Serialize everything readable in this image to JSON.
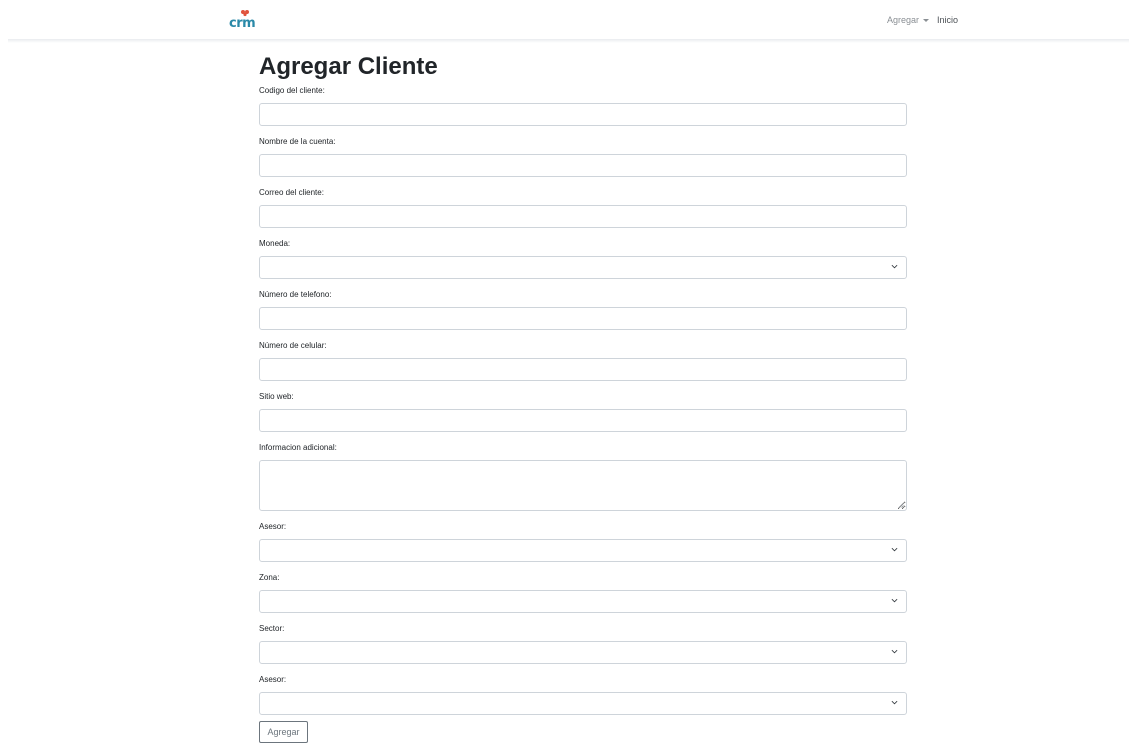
{
  "navbar": {
    "brand": "crm",
    "dropdown_label": "Agregar",
    "link_label": "Inicio"
  },
  "page": {
    "title": "Agregar Cliente"
  },
  "form": {
    "codigo_label": "Codigo del cliente:",
    "nombre_label": "Nombre de la cuenta:",
    "correo_label": "Correo del cliente:",
    "moneda_label": "Moneda:",
    "telefono_label": "Número de telefono:",
    "celular_label": "Número de celular:",
    "sitio_label": "Sitio web:",
    "info_label": "Informacion adicional:",
    "asesor_label": "Asesor:",
    "zona_label": "Zona:",
    "sector_label": "Sector:",
    "asesor2_label": "Asesor:",
    "submit_label": "Agregar"
  },
  "icons": {
    "brand": "crm-logo-icon",
    "dropdown": "caret-down-icon",
    "select": "chevron-down-icon",
    "resize": "resize-grip-icon"
  },
  "colors": {
    "brand": "#2a89a8",
    "brand_mark": "#e0533d",
    "input_border": "#ced4da",
    "button_border": "#6c757d"
  }
}
